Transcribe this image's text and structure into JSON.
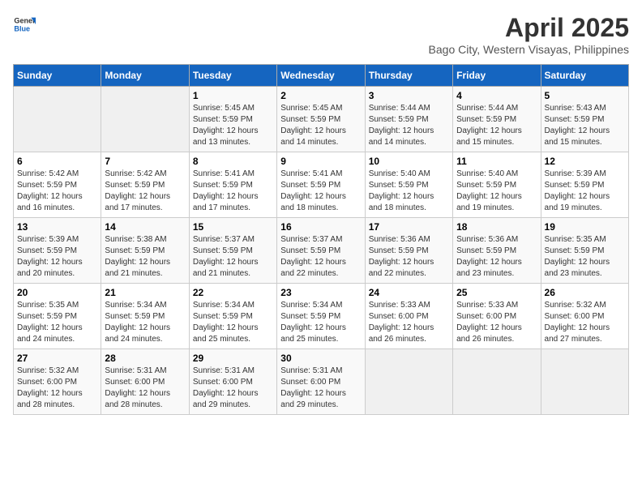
{
  "header": {
    "logo_general": "General",
    "logo_blue": "Blue",
    "month_year": "April 2025",
    "location": "Bago City, Western Visayas, Philippines"
  },
  "weekdays": [
    "Sunday",
    "Monday",
    "Tuesday",
    "Wednesday",
    "Thursday",
    "Friday",
    "Saturday"
  ],
  "weeks": [
    [
      {
        "day": "",
        "sunrise": "",
        "sunset": "",
        "daylight": ""
      },
      {
        "day": "",
        "sunrise": "",
        "sunset": "",
        "daylight": ""
      },
      {
        "day": "1",
        "sunrise": "Sunrise: 5:45 AM",
        "sunset": "Sunset: 5:59 PM",
        "daylight": "Daylight: 12 hours and 13 minutes."
      },
      {
        "day": "2",
        "sunrise": "Sunrise: 5:45 AM",
        "sunset": "Sunset: 5:59 PM",
        "daylight": "Daylight: 12 hours and 14 minutes."
      },
      {
        "day": "3",
        "sunrise": "Sunrise: 5:44 AM",
        "sunset": "Sunset: 5:59 PM",
        "daylight": "Daylight: 12 hours and 14 minutes."
      },
      {
        "day": "4",
        "sunrise": "Sunrise: 5:44 AM",
        "sunset": "Sunset: 5:59 PM",
        "daylight": "Daylight: 12 hours and 15 minutes."
      },
      {
        "day": "5",
        "sunrise": "Sunrise: 5:43 AM",
        "sunset": "Sunset: 5:59 PM",
        "daylight": "Daylight: 12 hours and 15 minutes."
      }
    ],
    [
      {
        "day": "6",
        "sunrise": "Sunrise: 5:42 AM",
        "sunset": "Sunset: 5:59 PM",
        "daylight": "Daylight: 12 hours and 16 minutes."
      },
      {
        "day": "7",
        "sunrise": "Sunrise: 5:42 AM",
        "sunset": "Sunset: 5:59 PM",
        "daylight": "Daylight: 12 hours and 17 minutes."
      },
      {
        "day": "8",
        "sunrise": "Sunrise: 5:41 AM",
        "sunset": "Sunset: 5:59 PM",
        "daylight": "Daylight: 12 hours and 17 minutes."
      },
      {
        "day": "9",
        "sunrise": "Sunrise: 5:41 AM",
        "sunset": "Sunset: 5:59 PM",
        "daylight": "Daylight: 12 hours and 18 minutes."
      },
      {
        "day": "10",
        "sunrise": "Sunrise: 5:40 AM",
        "sunset": "Sunset: 5:59 PM",
        "daylight": "Daylight: 12 hours and 18 minutes."
      },
      {
        "day": "11",
        "sunrise": "Sunrise: 5:40 AM",
        "sunset": "Sunset: 5:59 PM",
        "daylight": "Daylight: 12 hours and 19 minutes."
      },
      {
        "day": "12",
        "sunrise": "Sunrise: 5:39 AM",
        "sunset": "Sunset: 5:59 PM",
        "daylight": "Daylight: 12 hours and 19 minutes."
      }
    ],
    [
      {
        "day": "13",
        "sunrise": "Sunrise: 5:39 AM",
        "sunset": "Sunset: 5:59 PM",
        "daylight": "Daylight: 12 hours and 20 minutes."
      },
      {
        "day": "14",
        "sunrise": "Sunrise: 5:38 AM",
        "sunset": "Sunset: 5:59 PM",
        "daylight": "Daylight: 12 hours and 21 minutes."
      },
      {
        "day": "15",
        "sunrise": "Sunrise: 5:37 AM",
        "sunset": "Sunset: 5:59 PM",
        "daylight": "Daylight: 12 hours and 21 minutes."
      },
      {
        "day": "16",
        "sunrise": "Sunrise: 5:37 AM",
        "sunset": "Sunset: 5:59 PM",
        "daylight": "Daylight: 12 hours and 22 minutes."
      },
      {
        "day": "17",
        "sunrise": "Sunrise: 5:36 AM",
        "sunset": "Sunset: 5:59 PM",
        "daylight": "Daylight: 12 hours and 22 minutes."
      },
      {
        "day": "18",
        "sunrise": "Sunrise: 5:36 AM",
        "sunset": "Sunset: 5:59 PM",
        "daylight": "Daylight: 12 hours and 23 minutes."
      },
      {
        "day": "19",
        "sunrise": "Sunrise: 5:35 AM",
        "sunset": "Sunset: 5:59 PM",
        "daylight": "Daylight: 12 hours and 23 minutes."
      }
    ],
    [
      {
        "day": "20",
        "sunrise": "Sunrise: 5:35 AM",
        "sunset": "Sunset: 5:59 PM",
        "daylight": "Daylight: 12 hours and 24 minutes."
      },
      {
        "day": "21",
        "sunrise": "Sunrise: 5:34 AM",
        "sunset": "Sunset: 5:59 PM",
        "daylight": "Daylight: 12 hours and 24 minutes."
      },
      {
        "day": "22",
        "sunrise": "Sunrise: 5:34 AM",
        "sunset": "Sunset: 5:59 PM",
        "daylight": "Daylight: 12 hours and 25 minutes."
      },
      {
        "day": "23",
        "sunrise": "Sunrise: 5:34 AM",
        "sunset": "Sunset: 5:59 PM",
        "daylight": "Daylight: 12 hours and 25 minutes."
      },
      {
        "day": "24",
        "sunrise": "Sunrise: 5:33 AM",
        "sunset": "Sunset: 6:00 PM",
        "daylight": "Daylight: 12 hours and 26 minutes."
      },
      {
        "day": "25",
        "sunrise": "Sunrise: 5:33 AM",
        "sunset": "Sunset: 6:00 PM",
        "daylight": "Daylight: 12 hours and 26 minutes."
      },
      {
        "day": "26",
        "sunrise": "Sunrise: 5:32 AM",
        "sunset": "Sunset: 6:00 PM",
        "daylight": "Daylight: 12 hours and 27 minutes."
      }
    ],
    [
      {
        "day": "27",
        "sunrise": "Sunrise: 5:32 AM",
        "sunset": "Sunset: 6:00 PM",
        "daylight": "Daylight: 12 hours and 28 minutes."
      },
      {
        "day": "28",
        "sunrise": "Sunrise: 5:31 AM",
        "sunset": "Sunset: 6:00 PM",
        "daylight": "Daylight: 12 hours and 28 minutes."
      },
      {
        "day": "29",
        "sunrise": "Sunrise: 5:31 AM",
        "sunset": "Sunset: 6:00 PM",
        "daylight": "Daylight: 12 hours and 29 minutes."
      },
      {
        "day": "30",
        "sunrise": "Sunrise: 5:31 AM",
        "sunset": "Sunset: 6:00 PM",
        "daylight": "Daylight: 12 hours and 29 minutes."
      },
      {
        "day": "",
        "sunrise": "",
        "sunset": "",
        "daylight": ""
      },
      {
        "day": "",
        "sunrise": "",
        "sunset": "",
        "daylight": ""
      },
      {
        "day": "",
        "sunrise": "",
        "sunset": "",
        "daylight": ""
      }
    ]
  ]
}
